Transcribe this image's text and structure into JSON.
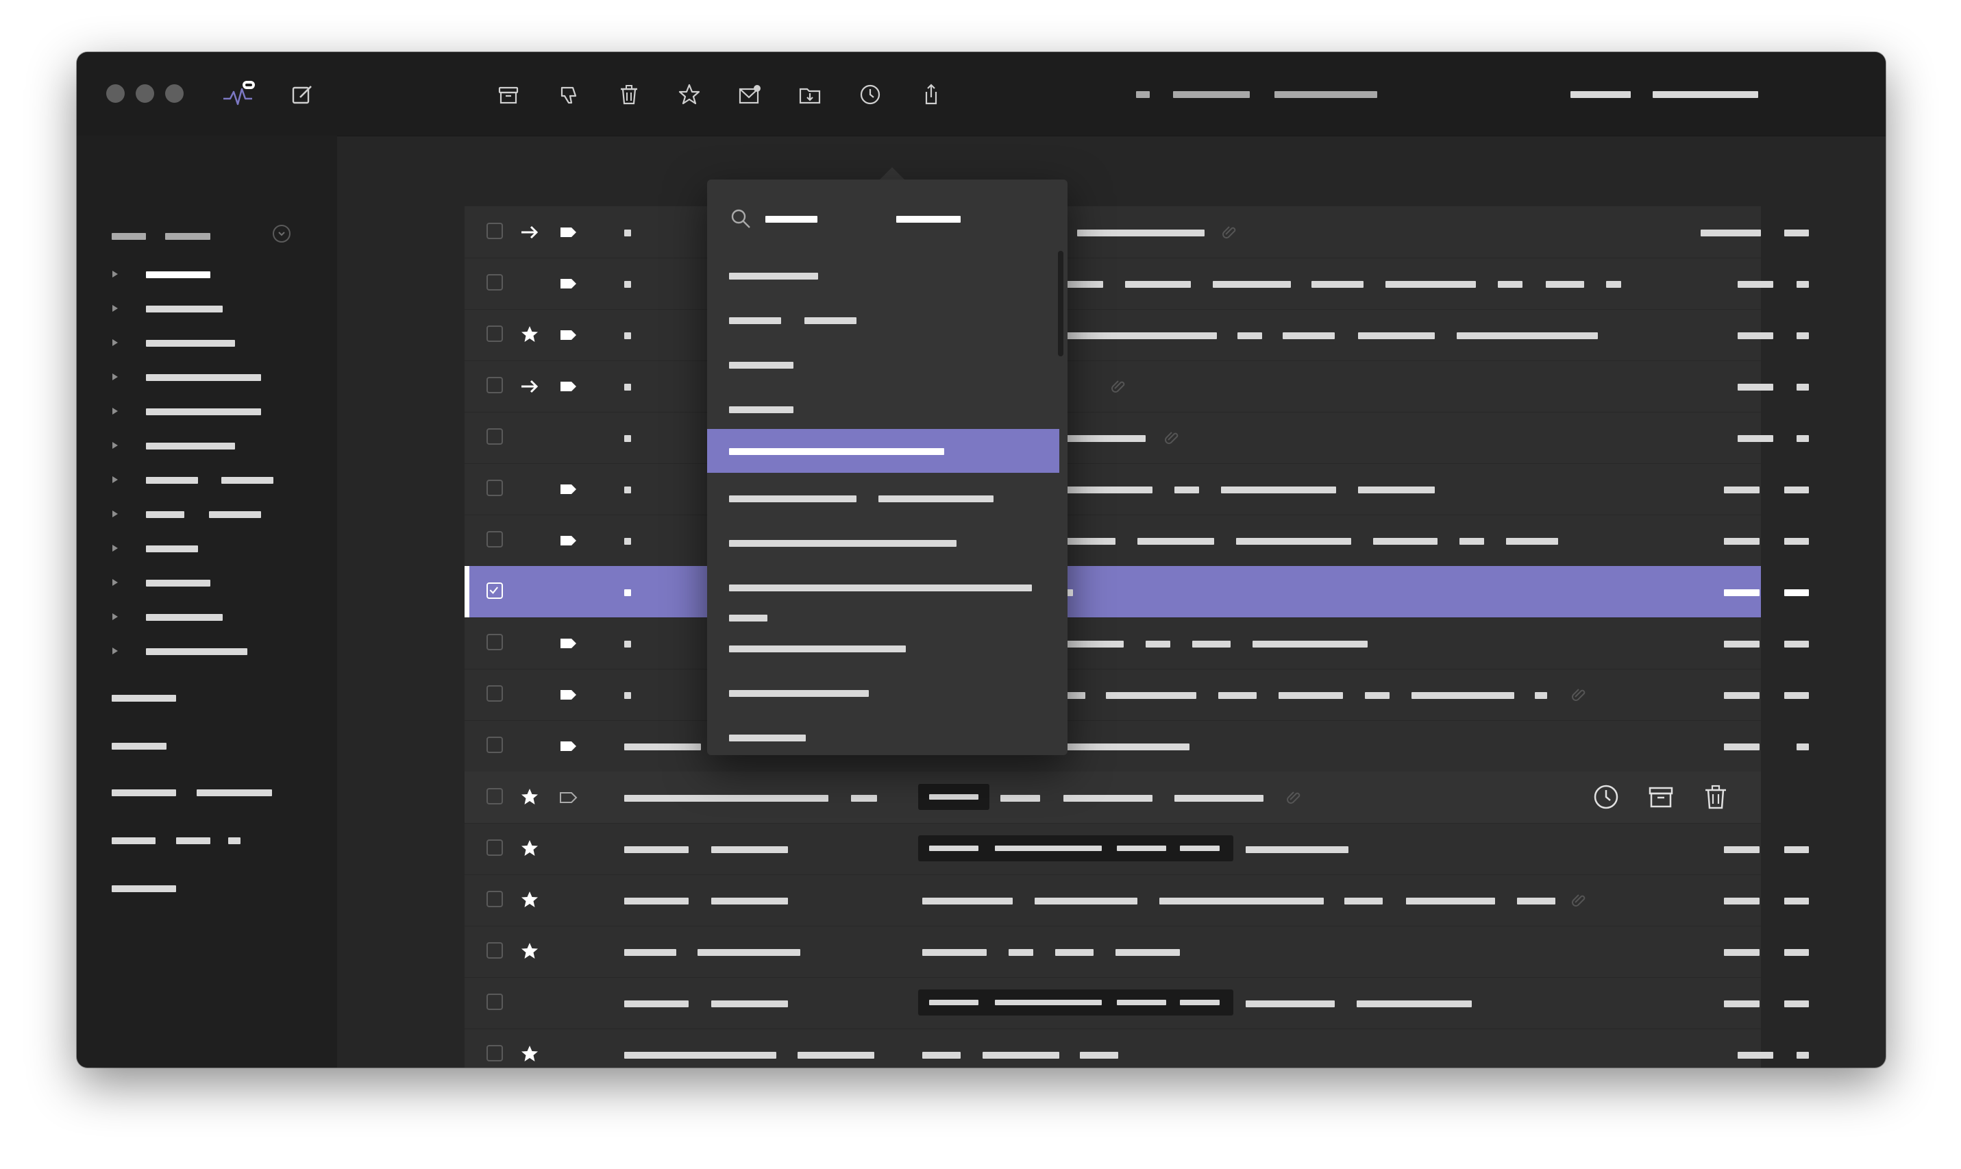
{
  "app": {
    "name": "Mail client",
    "accent_color": "#7c78c3",
    "window_bg": "#262626"
  },
  "toolbar": {
    "icons": [
      {
        "name": "archive-icon"
      },
      {
        "name": "thumbs-down-icon"
      },
      {
        "name": "trash-icon"
      },
      {
        "name": "star-icon"
      },
      {
        "name": "mark-unread-icon"
      },
      {
        "name": "move-to-folder-icon"
      },
      {
        "name": "snooze-clock-icon"
      },
      {
        "name": "share-icon"
      }
    ]
  },
  "move_menu": {
    "open": true,
    "search_placeholder": "",
    "active_index": 4,
    "item_count": 11
  },
  "message_list": {
    "selected_row": 7,
    "hover_row": 11,
    "row_count": 17,
    "hover_actions": [
      "snooze-clock-icon",
      "archive-icon",
      "trash-icon"
    ]
  }
}
